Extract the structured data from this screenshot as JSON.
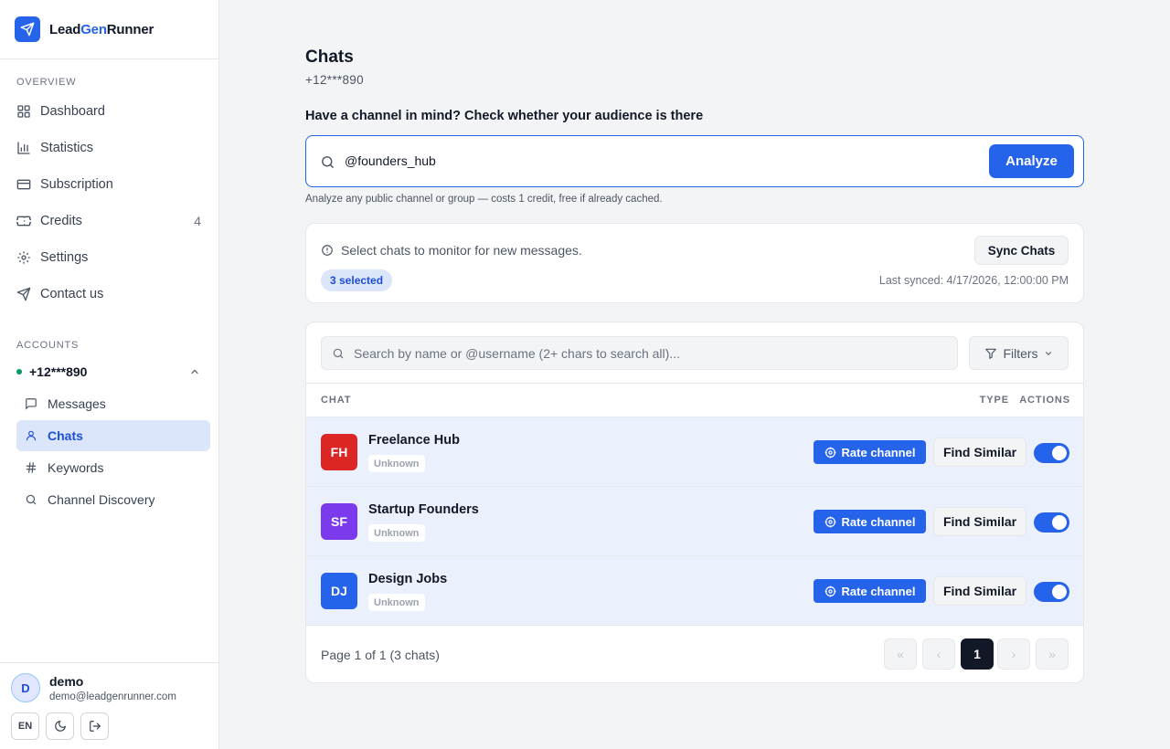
{
  "brand": {
    "part1": "Lead",
    "part2": "Gen",
    "part3": "Runner"
  },
  "sidebar": {
    "overview_title": "OVERVIEW",
    "nav": [
      {
        "label": "Dashboard",
        "icon": "dashboard-icon"
      },
      {
        "label": "Statistics",
        "icon": "bar-chart-icon"
      },
      {
        "label": "Subscription",
        "icon": "credit-card-icon"
      },
      {
        "label": "Credits",
        "icon": "ticket-icon",
        "count": "4"
      },
      {
        "label": "Settings",
        "icon": "gear-icon"
      },
      {
        "label": "Contact us",
        "icon": "send-icon"
      }
    ],
    "accounts_title": "ACCOUNTS",
    "account": {
      "phone": "+12***890",
      "status_color": "#059669"
    },
    "sub_nav": [
      {
        "label": "Messages",
        "icon": "message-icon"
      },
      {
        "label": "Chats",
        "icon": "user-icon",
        "active": true
      },
      {
        "label": "Keywords",
        "icon": "hash-icon"
      },
      {
        "label": "Channel Discovery",
        "icon": "search-icon"
      }
    ]
  },
  "user": {
    "initial": "D",
    "name": "demo",
    "email": "demo@leadgenrunner.com",
    "lang": "EN"
  },
  "page": {
    "title": "Chats",
    "subtitle": "+12***890",
    "prompt": "Have a channel in mind? Check whether your audience is there",
    "analyze_value": "@founders_hub",
    "analyze_button": "Analyze",
    "hint": "Analyze any public channel or group — costs 1 credit, free if already cached."
  },
  "sync": {
    "info": "Select chats to monitor for new messages.",
    "button": "Sync Chats",
    "selected": "3 selected",
    "last_synced": "Last synced: 4/17/2026, 12:00:00 PM"
  },
  "table": {
    "search_placeholder": "Search by name or @username (2+ chars to search all)...",
    "filters_label": "Filters",
    "headers": {
      "chat": "CHAT",
      "type": "TYPE",
      "actions": "ACTIONS"
    },
    "rows": [
      {
        "initials": "FH",
        "name": "Freelance Hub",
        "type": "Unknown",
        "color": "#dc2626",
        "rate_label": "Rate channel",
        "similar_label": "Find Similar",
        "monitored": true
      },
      {
        "initials": "SF",
        "name": "Startup Founders",
        "type": "Unknown",
        "color": "#7c3aed",
        "rate_label": "Rate channel",
        "similar_label": "Find Similar",
        "monitored": true
      },
      {
        "initials": "DJ",
        "name": "Design Jobs",
        "type": "Unknown",
        "color": "#2563eb",
        "rate_label": "Rate channel",
        "similar_label": "Find Similar",
        "monitored": true
      }
    ],
    "pagination": {
      "text": "Page 1 of 1 (3 chats)",
      "current": "1",
      "first": "«",
      "prev": "‹",
      "next": "›",
      "last": "»"
    }
  },
  "colors": {
    "accent": "#2563eb",
    "row_selected": "#eaf0fc"
  }
}
